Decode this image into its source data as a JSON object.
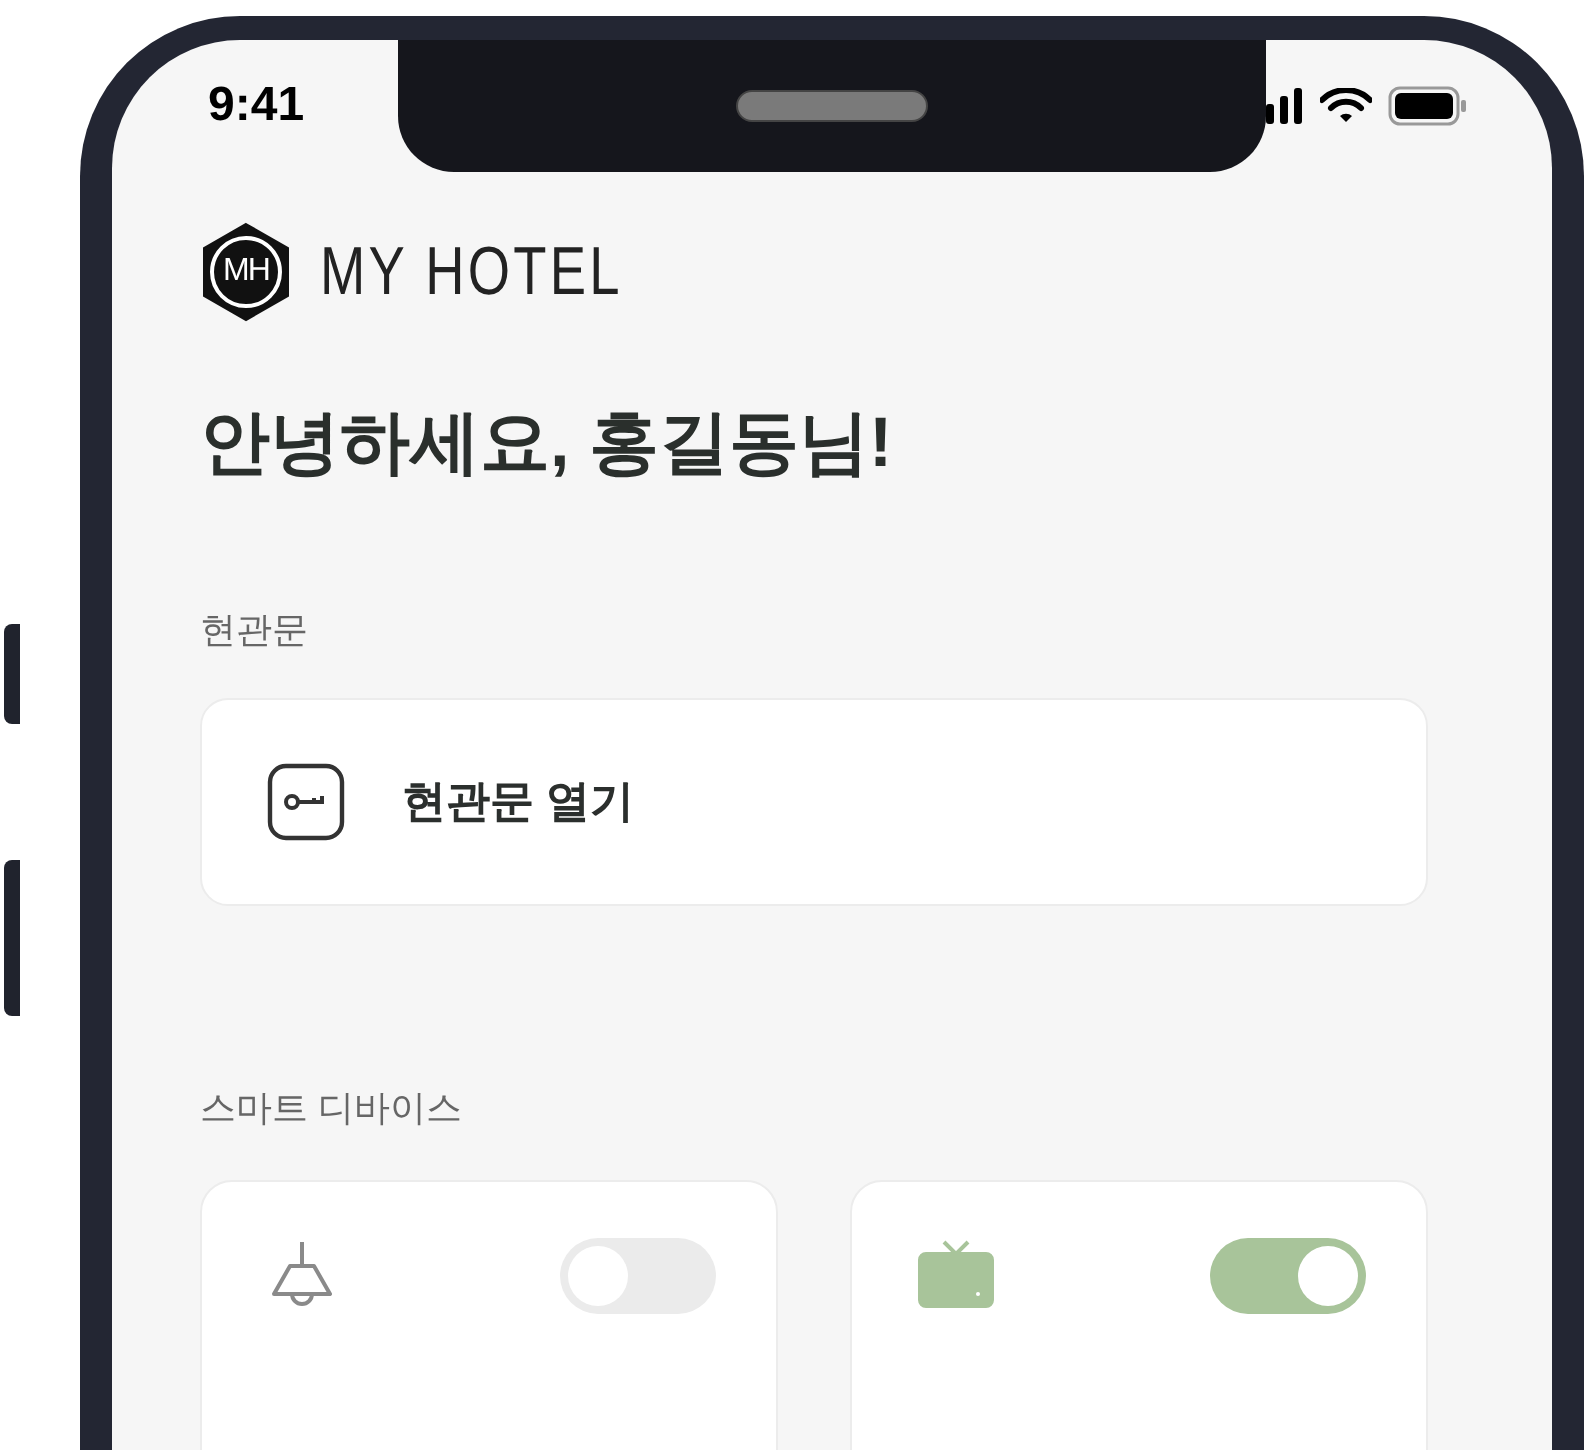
{
  "status_bar": {
    "time": "9:41"
  },
  "logo": {
    "mark": "MH",
    "name": "MY HOTEL"
  },
  "greeting": "안녕하세요, 홍길동님!",
  "entrance": {
    "label": "현관문",
    "action": "현관문 열기"
  },
  "smart_devices": {
    "label": "스마트 디바이스",
    "devices": [
      {
        "kind": "lamp",
        "on": false
      },
      {
        "kind": "tv",
        "on": true
      }
    ]
  }
}
